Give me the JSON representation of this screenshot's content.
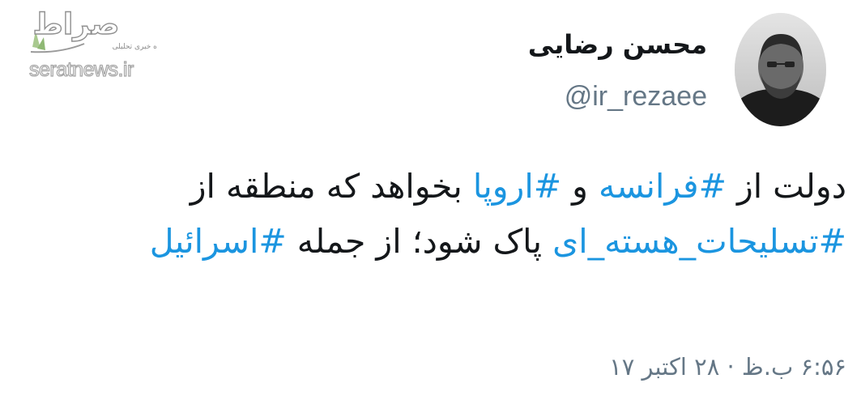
{
  "watermark": {
    "logo_text": "صراط",
    "tagline": "پایگاه خبری تحلیلی",
    "url": "seratnews.ir"
  },
  "user": {
    "display_name": "محسن رضایی",
    "handle": "@ir_rezaee",
    "avatar_icon": "profile-photo"
  },
  "tweet": {
    "segments": [
      {
        "text": "دولت از ",
        "hashtag": false
      },
      {
        "text": "#فرانسه",
        "hashtag": true
      },
      {
        "text": " و ",
        "hashtag": false
      },
      {
        "text": "#اروپا",
        "hashtag": true
      },
      {
        "text": " بخواهد که منطقه از ",
        "hashtag": false
      },
      {
        "text": "#تسلیحات_هسته_ای",
        "hashtag": true
      },
      {
        "text": " پاک شود؛ از جمله ",
        "hashtag": false
      },
      {
        "text": "#اسرائیل",
        "hashtag": true
      }
    ],
    "timestamp": "۶:۵۶ ب.ظ · ۲۸ اکتبر ۱۷"
  },
  "colors": {
    "text": "#14171a",
    "hashtag": "#1b95e0",
    "secondary": "#657786",
    "background": "#ffffff"
  }
}
